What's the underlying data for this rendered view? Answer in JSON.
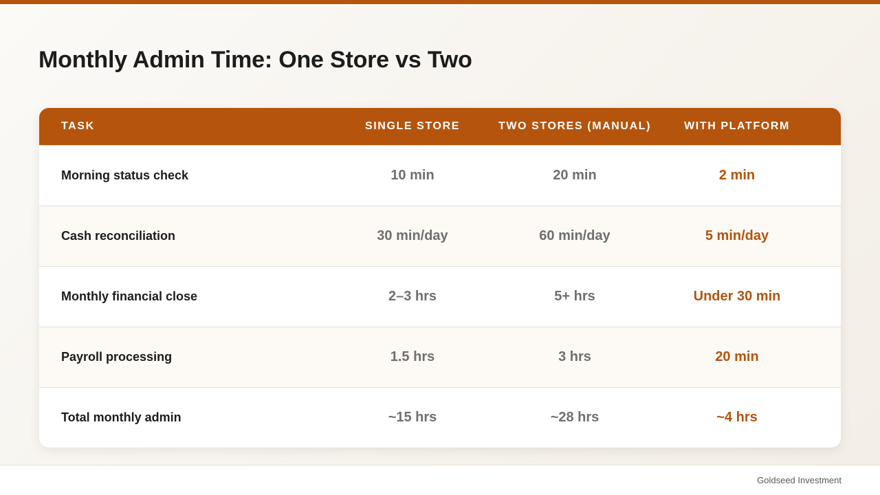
{
  "title": "Monthly Admin Time: One Store vs Two",
  "colors": {
    "accent": "#b5540c",
    "muted_value": "#6f6f6f",
    "alt_row": "#fdf9f5"
  },
  "table": {
    "headers": [
      "TASK",
      "SINGLE STORE",
      "TWO STORES (MANUAL)",
      "WITH PLATFORM"
    ],
    "rows": [
      {
        "task": "Morning status check",
        "single": "10 min",
        "two": "20 min",
        "platform": "2 min"
      },
      {
        "task": "Cash reconciliation",
        "single": "30 min/day",
        "two": "60 min/day",
        "platform": "5 min/day"
      },
      {
        "task": "Monthly financial close",
        "single": "2–3 hrs",
        "two": "5+ hrs",
        "platform": "Under 30 min"
      },
      {
        "task": "Payroll processing",
        "single": "1.5 hrs",
        "two": "3 hrs",
        "platform": "20 min"
      },
      {
        "task": "Total monthly admin",
        "single": "~15 hrs",
        "two": "~28 hrs",
        "platform": "~4 hrs"
      }
    ]
  },
  "footer": {
    "brand": "Goldseed Investment"
  }
}
